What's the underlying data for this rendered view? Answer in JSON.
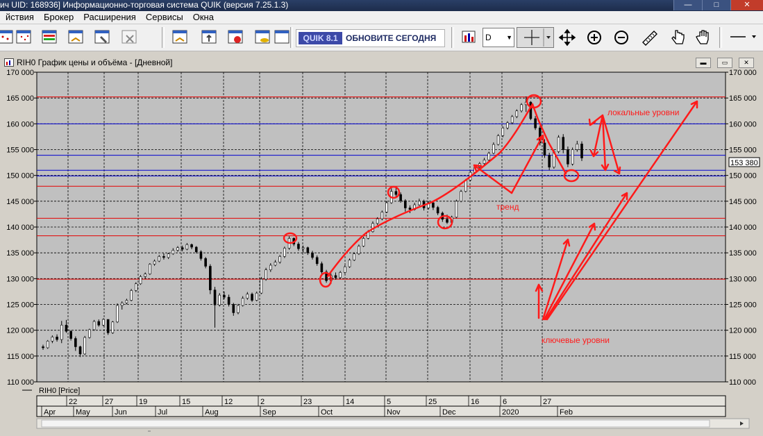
{
  "window": {
    "title": "ич UID: 168936] Информационно-торговая система QUIK (версия 7.25.1.3)",
    "controls": {
      "minimize": "—",
      "maximize": "□",
      "close": "✕"
    }
  },
  "menu": {
    "items": [
      "йствия",
      "Брокер",
      "Расширения",
      "Сервисы",
      "Окна"
    ]
  },
  "toolbar": {
    "quik_badge": "QUIK 8.1",
    "update_text": "ОБНОВИТЕ СЕГОДНЯ",
    "timeframe": "D"
  },
  "chart_window": {
    "title": "RIH0 График цены и объёма - [Дневной]",
    "legend": "RIH0 [Price]",
    "last_price_label": "153 380"
  },
  "annotations": {
    "local_levels": "локальные уровни",
    "trend": "тренд",
    "key_levels": "ключевые уровни"
  },
  "colors": {
    "plot_bg": "#c0c0c0",
    "red_level": "#e60000",
    "blue_level": "#0000d0",
    "annotation": "#ff1a1a"
  },
  "chart_data": {
    "type": "bar",
    "title": "RIH0 График цены и объёма - [Дневной]",
    "ylim": [
      110000,
      170000
    ],
    "y_ticks": [
      "110 000",
      "115 000",
      "120 000",
      "125 000",
      "130 000",
      "135 000",
      "140 000",
      "145 000",
      "150 000",
      "155 000",
      "160 000",
      "165 000",
      "170 000"
    ],
    "x_day_ticks": [
      "22",
      "27",
      "19",
      "15",
      "12",
      "2",
      "23",
      "14",
      "5",
      "25",
      "16",
      "6",
      "27"
    ],
    "x_month_ticks": [
      "Apr",
      "May",
      "Jun",
      "Jul",
      "Aug",
      "Sep",
      "Oct",
      "Nov",
      "Dec",
      "2020",
      "Feb"
    ],
    "grid": true,
    "red_levels": [
      165200,
      147900,
      141700,
      138300,
      129900
    ],
    "blue_levels": [
      160000,
      153900,
      151000,
      149900
    ],
    "last_price": 153380,
    "series": [
      {
        "values": [
          [
            116800,
            117200,
            116200,
            116600
          ],
          [
            116600,
            118100,
            116400,
            117900
          ],
          [
            117900,
            119000,
            117500,
            118700
          ],
          [
            118700,
            119200,
            117800,
            118200
          ],
          [
            118200,
            121800,
            117500,
            121000
          ],
          [
            121000,
            122000,
            119500,
            119800
          ],
          [
            119800,
            120000,
            118000,
            118400
          ],
          [
            118400,
            118800,
            116000,
            116800
          ],
          [
            116800,
            117000,
            114800,
            115400
          ],
          [
            115400,
            118900,
            115200,
            118600
          ],
          [
            118600,
            120300,
            118400,
            120100
          ],
          [
            120100,
            122000,
            119900,
            121700
          ],
          [
            121700,
            122100,
            120700,
            121000
          ],
          [
            121000,
            122300,
            120800,
            122100
          ],
          [
            122100,
            121900,
            119100,
            119500
          ],
          [
            119500,
            121800,
            119300,
            121600
          ],
          [
            121600,
            125200,
            121400,
            124800
          ],
          [
            124800,
            125600,
            124000,
            125300
          ],
          [
            125300,
            126100,
            125000,
            125800
          ],
          [
            125800,
            128000,
            125600,
            127700
          ],
          [
            127700,
            129300,
            127400,
            129000
          ],
          [
            129000,
            130700,
            128800,
            130400
          ],
          [
            130400,
            131200,
            130000,
            130900
          ],
          [
            130900,
            133000,
            130700,
            132800
          ],
          [
            132800,
            133700,
            132500,
            133400
          ],
          [
            133400,
            134600,
            133200,
            134300
          ],
          [
            134300,
            134900,
            133700,
            134100
          ],
          [
            134100,
            135000,
            133800,
            134800
          ],
          [
            134800,
            135900,
            134600,
            135500
          ],
          [
            135500,
            136300,
            135200,
            136000
          ],
          [
            136000,
            136400,
            135300,
            135700
          ],
          [
            135700,
            136900,
            135500,
            136600
          ],
          [
            136600,
            136800,
            135700,
            136100
          ],
          [
            136100,
            136300,
            134900,
            135200
          ],
          [
            135200,
            135500,
            133500,
            133900
          ],
          [
            133900,
            134200,
            132000,
            132400
          ],
          [
            132400,
            132800,
            127000,
            127800
          ],
          [
            127800,
            128400,
            120500,
            124900
          ],
          [
            124900,
            127200,
            124600,
            126800
          ],
          [
            126800,
            127500,
            126000,
            126400
          ],
          [
            126400,
            126900,
            124600,
            125000
          ],
          [
            125000,
            125300,
            122800,
            123400
          ],
          [
            123400,
            125100,
            123100,
            124800
          ],
          [
            124800,
            126600,
            124600,
            126200
          ],
          [
            126200,
            127400,
            125900,
            127000
          ],
          [
            127000,
            127300,
            125500,
            125800
          ],
          [
            125800,
            127500,
            125600,
            127200
          ],
          [
            127200,
            130300,
            127000,
            129900
          ],
          [
            129900,
            132100,
            129600,
            131700
          ],
          [
            131700,
            133000,
            131300,
            132600
          ],
          [
            132600,
            133600,
            132400,
            133200
          ],
          [
            133200,
            134600,
            132900,
            134300
          ],
          [
            134300,
            136200,
            134000,
            135900
          ],
          [
            135900,
            138200,
            135600,
            137800
          ],
          [
            137800,
            138000,
            136300,
            136700
          ],
          [
            136700,
            137100,
            135400,
            135800
          ],
          [
            135800,
            136400,
            135000,
            136000
          ],
          [
            136000,
            136200,
            134600,
            135000
          ],
          [
            135000,
            135400,
            133700,
            134100
          ],
          [
            134100,
            134500,
            132500,
            132900
          ],
          [
            132900,
            133300,
            130900,
            131300
          ],
          [
            131300,
            131700,
            129200,
            129600
          ],
          [
            129600,
            131000,
            129000,
            130600
          ],
          [
            130600,
            131200,
            129800,
            130200
          ],
          [
            130200,
            131500,
            130000,
            131200
          ],
          [
            131200,
            132600,
            131000,
            132300
          ],
          [
            132300,
            133900,
            132100,
            133600
          ],
          [
            133600,
            135100,
            133400,
            134800
          ],
          [
            134800,
            136600,
            134600,
            136300
          ],
          [
            136300,
            138100,
            136100,
            137800
          ],
          [
            137800,
            139400,
            137600,
            139100
          ],
          [
            139100,
            141100,
            138900,
            140700
          ],
          [
            140700,
            141900,
            140400,
            141600
          ],
          [
            141600,
            143200,
            141300,
            142900
          ],
          [
            142900,
            145000,
            142700,
            144700
          ],
          [
            144700,
            147500,
            144500,
            146900
          ],
          [
            146900,
            147800,
            145600,
            146300
          ],
          [
            146300,
            146700,
            144700,
            145100
          ],
          [
            145100,
            145400,
            143000,
            143700
          ],
          [
            143700,
            144200,
            142700,
            143400
          ],
          [
            143400,
            144700,
            143200,
            144300
          ],
          [
            144300,
            145500,
            144100,
            145000
          ],
          [
            145000,
            145300,
            143200,
            143700
          ],
          [
            143700,
            145000,
            143400,
            144700
          ],
          [
            144700,
            145100,
            143300,
            143800
          ],
          [
            143800,
            144100,
            142300,
            142700
          ],
          [
            142700,
            143000,
            141000,
            141500
          ],
          [
            141500,
            142400,
            140600,
            140900
          ],
          [
            140900,
            142200,
            140700,
            141900
          ],
          [
            141900,
            145300,
            141700,
            145000
          ],
          [
            145000,
            147200,
            144800,
            146900
          ],
          [
            146900,
            149300,
            146700,
            149100
          ],
          [
            149100,
            150900,
            148900,
            150600
          ],
          [
            150600,
            151900,
            150300,
            151600
          ],
          [
            151600,
            152600,
            151300,
            152300
          ],
          [
            152300,
            153400,
            152000,
            153000
          ],
          [
            153000,
            154600,
            152800,
            154300
          ],
          [
            154300,
            156400,
            154100,
            156000
          ],
          [
            156000,
            158000,
            155800,
            157700
          ],
          [
            157700,
            159500,
            157400,
            159200
          ],
          [
            159200,
            160500,
            158900,
            160200
          ],
          [
            160200,
            161700,
            159900,
            161400
          ],
          [
            161400,
            162800,
            161100,
            162500
          ],
          [
            162500,
            164000,
            162200,
            163700
          ],
          [
            163700,
            165300,
            162300,
            164200
          ],
          [
            164200,
            164400,
            160700,
            161000
          ],
          [
            161000,
            161500,
            158800,
            159200
          ],
          [
            159200,
            159600,
            155800,
            156300
          ],
          [
            156300,
            157000,
            153400,
            153900
          ],
          [
            153900,
            154400,
            151000,
            151600
          ],
          [
            151600,
            155000,
            151300,
            154600
          ],
          [
            154600,
            157800,
            154300,
            157400
          ],
          [
            157400,
            158000,
            154300,
            155000
          ],
          [
            155000,
            155600,
            151600,
            152200
          ],
          [
            152200,
            155400,
            151900,
            155000
          ],
          [
            155000,
            156700,
            154600,
            156100
          ],
          [
            156100,
            156600,
            152800,
            153380
          ]
        ]
      }
    ]
  }
}
